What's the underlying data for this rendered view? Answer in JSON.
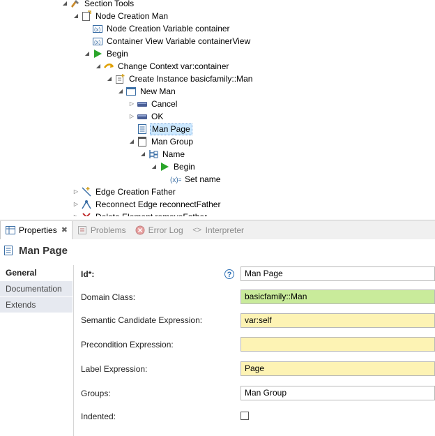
{
  "tree": {
    "items": [
      {
        "label": "Section Tools",
        "icon": "section-tools-icon",
        "twisty": "expanded"
      },
      {
        "label": "Node Creation Man",
        "icon": "node-creation-icon",
        "twisty": "expanded"
      },
      {
        "label": "Node Creation Variable container",
        "icon": "variable-icon",
        "twisty": "none"
      },
      {
        "label": "Container View Variable containerView",
        "icon": "variable-icon",
        "twisty": "none"
      },
      {
        "label": "Begin",
        "icon": "begin-icon",
        "twisty": "expanded"
      },
      {
        "label": "Change Context var:container",
        "icon": "change-context-icon",
        "twisty": "expanded"
      },
      {
        "label": "Create Instance basicfamily::Man",
        "icon": "create-instance-icon",
        "twisty": "expanded"
      },
      {
        "label": "New Man",
        "icon": "dialog-icon",
        "twisty": "expanded"
      },
      {
        "label": "Cancel",
        "icon": "button-icon",
        "twisty": "collapsed"
      },
      {
        "label": "OK",
        "icon": "button-icon",
        "twisty": "collapsed"
      },
      {
        "label": "Man Page",
        "icon": "page-icon",
        "twisty": "none",
        "selected": true
      },
      {
        "label": "Man Group",
        "icon": "group-icon",
        "twisty": "expanded"
      },
      {
        "label": "Name",
        "icon": "widget-icon",
        "twisty": "expanded"
      },
      {
        "label": "Begin",
        "icon": "begin-icon",
        "twisty": "expanded"
      },
      {
        "label": "Set name",
        "icon": "set-icon",
        "twisty": "none"
      },
      {
        "label": "Edge Creation Father",
        "icon": "edge-creation-icon",
        "twisty": "collapsed"
      },
      {
        "label": "Reconnect Edge reconnectFather",
        "icon": "reconnect-icon",
        "twisty": "collapsed"
      },
      {
        "label": "Delete Element removeFather",
        "icon": "delete-icon",
        "twisty": "collapsed"
      }
    ]
  },
  "tabs": [
    {
      "label": "Properties",
      "icon": "properties-icon",
      "active": true
    },
    {
      "label": "Problems",
      "icon": "problems-icon"
    },
    {
      "label": "Error Log",
      "icon": "error-log-icon"
    },
    {
      "label": "Interpreter",
      "icon": "interpreter-icon"
    }
  ],
  "properties": {
    "title": "Man Page",
    "side_tabs": [
      "General",
      "Documentation",
      "Extends"
    ],
    "fields": [
      {
        "label": "Id*:",
        "value": "Man Page",
        "bg": "#ffffff",
        "help": true
      },
      {
        "label": "Domain Class:",
        "value": "basicfamily::Man",
        "bg": "#c9eb9b"
      },
      {
        "label": "Semantic Candidate Expression:",
        "value": "var:self",
        "bg": "#fdf3b4"
      },
      {
        "label": "Precondition Expression:",
        "value": "",
        "bg": "#fdf3b4"
      },
      {
        "label": "Label Expression:",
        "value": "Page",
        "bg": "#fdf3b4"
      },
      {
        "label": "Groups:",
        "value": "Man Group",
        "bg": "#ffffff"
      },
      {
        "label": "Indented:",
        "value": "",
        "checkbox": true
      }
    ]
  },
  "colors": {
    "selection": "#cce8ff",
    "green_field": "#c9eb9b",
    "yellow_field": "#fdf3b4",
    "begin_green": "#2aa52a"
  }
}
